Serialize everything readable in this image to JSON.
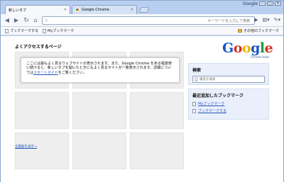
{
  "window": {
    "brand": "Google",
    "controls": [
      "–",
      "□",
      "✕"
    ]
  },
  "tabs": [
    {
      "label": "新しいタブ",
      "active": true
    },
    {
      "label": "Google Chrome",
      "active": false
    }
  ],
  "toolbar": {
    "back_icon": "arrow-left",
    "forward_icon": "arrow-right",
    "reload_icon": "reload",
    "omnibox_placeholder": "キーワードを入力して検索",
    "go_glyph": "▶",
    "page_menu_glyph": "▤▾",
    "tools_menu_glyph": "✎▾"
  },
  "bookmark_bar": {
    "items": [
      "ブックマークする",
      "Myブックマーク"
    ],
    "other": "その他のブックマーク"
  },
  "most_visited": {
    "title": "よくアクセスするページ",
    "message_before_link": "ここには最もよく見るウェブサイトが表示されます。また、Google Chrome をある程度使い続けると、新しいタブを開いたときにもよく見るサイトが一覧表示されます。詳細については",
    "message_link": "スタートガイド",
    "message_after_link": "をご覧ください。",
    "thumbnails": 9,
    "show_all": "全履歴を表示 »"
  },
  "logo": {
    "letters": [
      {
        "ch": "G",
        "color": "#1a56c4"
      },
      {
        "ch": "o",
        "color": "#d0321f"
      },
      {
        "ch": "o",
        "color": "#f0b400"
      },
      {
        "ch": "g",
        "color": "#1a56c4"
      },
      {
        "ch": "l",
        "color": "#1f9a3a"
      },
      {
        "ch": "e",
        "color": "#d0321f"
      }
    ],
    "subtitle": "Chrome beta"
  },
  "search_panel": {
    "title": "検索",
    "placeholder": "履歴を検索"
  },
  "recent_bookmarks": {
    "title": "最近追加したブックマーク",
    "items": [
      "Myブックマーク",
      "ブックマークする"
    ]
  },
  "colors": {
    "frame": "#b9cff0",
    "link": "#2255bb",
    "panel": "#eaf0fb"
  }
}
